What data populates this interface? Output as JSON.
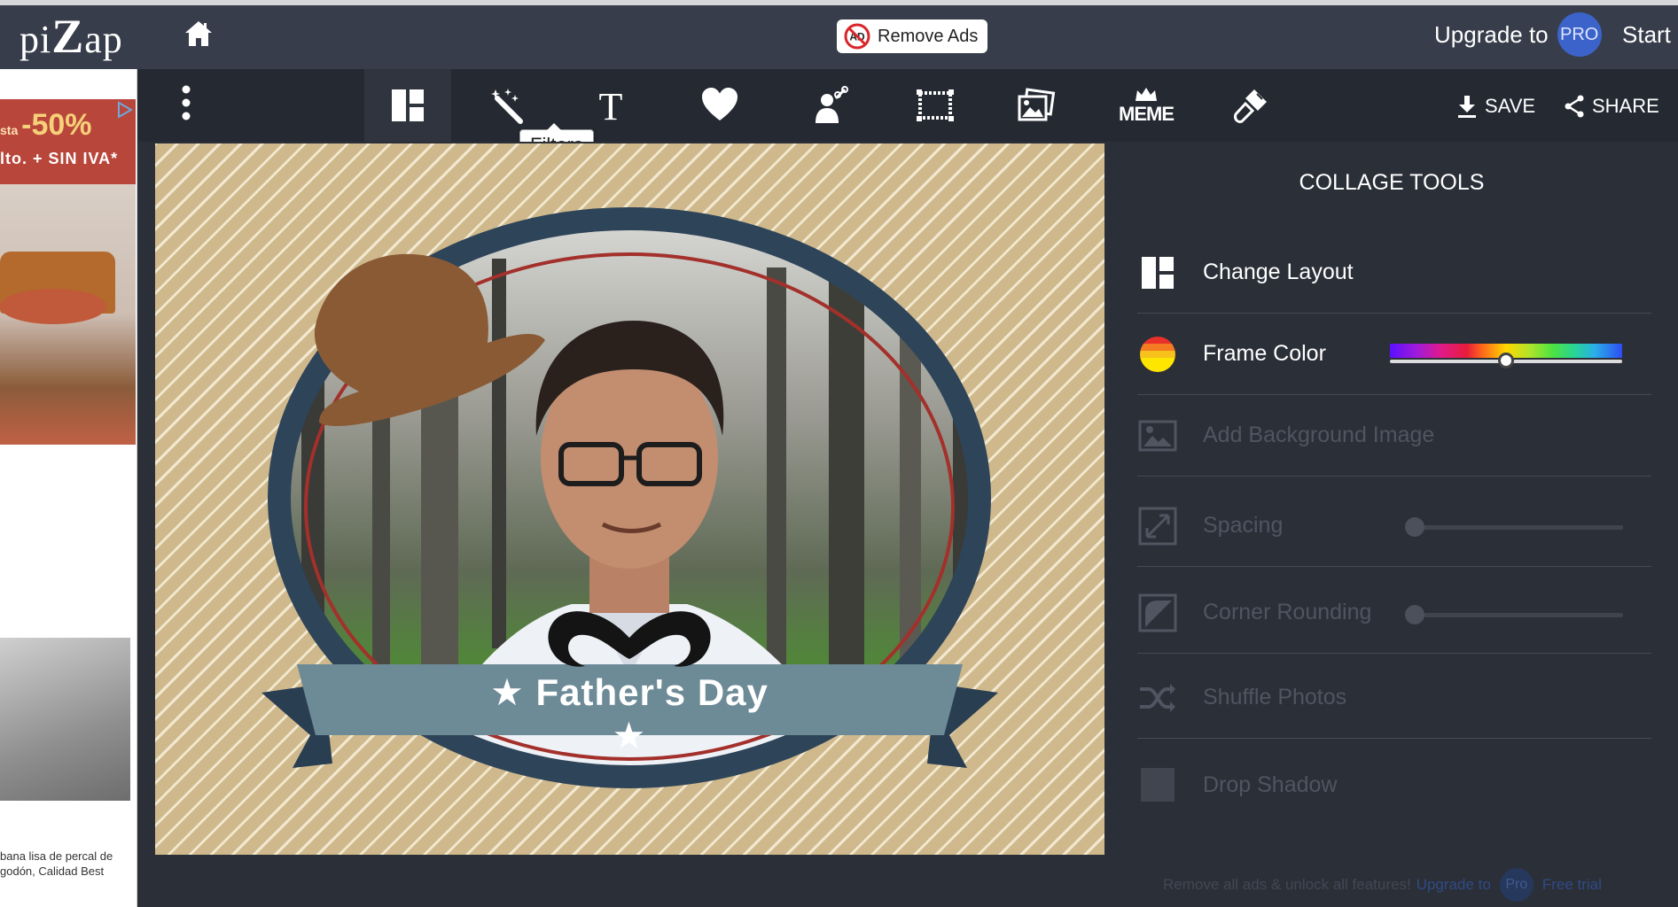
{
  "header": {
    "logo_prefix": "pi",
    "logo_big": "Z",
    "logo_suffix": "ap",
    "remove_ads_label": "Remove Ads",
    "upgrade_label": "Upgrade to",
    "pro_badge": "PRO",
    "start_label": "Start"
  },
  "ad": {
    "sale_prefix": "sta",
    "sale_percent": "-50%",
    "sale_line2": "lto. + SIN IVA*",
    "caption": "bana lisa de percal de godón, Calidad Best"
  },
  "toolbar": {
    "tools": [
      "collage-layout",
      "filters",
      "text",
      "stickers",
      "paint",
      "borders",
      "photos",
      "meme",
      "touch-up"
    ],
    "active_tool": "collage-layout",
    "meme_label": "MEME",
    "tooltip": "Filters",
    "save_label": "SAVE",
    "share_label": "SHARE"
  },
  "canvas": {
    "banner_text": "Father's Day"
  },
  "panel": {
    "title": "COLLAGE TOOLS",
    "items": [
      {
        "label": "Change Layout",
        "icon": "layout-icon",
        "enabled": true
      },
      {
        "label": "Frame Color",
        "icon": "color-wheel-icon",
        "enabled": true
      },
      {
        "label": "Add Background Image",
        "icon": "image-icon",
        "enabled": false
      },
      {
        "label": "Spacing",
        "icon": "resize-icon",
        "enabled": false
      },
      {
        "label": "Corner Rounding",
        "icon": "corner-icon",
        "enabled": false
      },
      {
        "label": "Shuffle Photos",
        "icon": "shuffle-icon",
        "enabled": false
      },
      {
        "label": "Drop Shadow",
        "icon": "shadow-icon",
        "enabled": false
      }
    ],
    "frame_color_value": 0.5,
    "spacing_value": 0,
    "corner_rounding_value": 0,
    "footer_text": "Remove all ads & unlock all features!",
    "footer_upgrade": "Upgrade to",
    "footer_pro": "Pro",
    "footer_trial": "Free trial"
  }
}
